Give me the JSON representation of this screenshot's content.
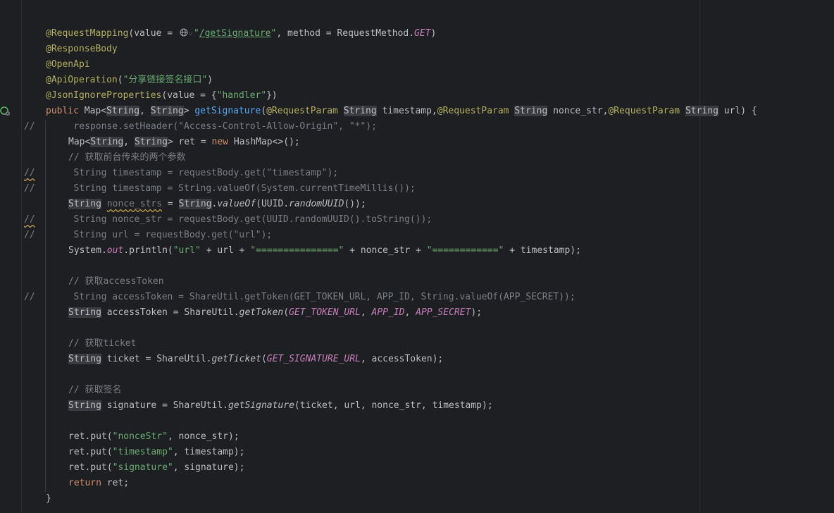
{
  "editor": {
    "lines": [
      {
        "parts": [
          {
            "t": "@RequestMapping",
            "c": "ann"
          },
          {
            "t": "(value = ",
            "c": ""
          },
          {
            "icon": "web-endpoint-icon"
          },
          {
            "t": "\"",
            "c": "str"
          },
          {
            "t": "/getSignature",
            "c": "ulink"
          },
          {
            "t": "\"",
            "c": "str"
          },
          {
            "t": ", method = RequestMethod.",
            "c": ""
          },
          {
            "t": "GET",
            "c": "fld"
          },
          {
            "t": ")",
            "c": ""
          }
        ]
      },
      {
        "parts": [
          {
            "t": "@ResponseBody",
            "c": "ann"
          }
        ]
      },
      {
        "parts": [
          {
            "t": "@OpenApi",
            "c": "ann"
          }
        ]
      },
      {
        "parts": [
          {
            "t": "@ApiOperation",
            "c": "ann"
          },
          {
            "t": "(",
            "c": ""
          },
          {
            "t": "\"分享链接签名接口\"",
            "c": "str"
          },
          {
            "t": ")",
            "c": ""
          }
        ]
      },
      {
        "parts": [
          {
            "t": "@JsonIgnoreProperties",
            "c": "ann"
          },
          {
            "t": "(value = {",
            "c": ""
          },
          {
            "t": "\"handler\"",
            "c": "str"
          },
          {
            "t": "})",
            "c": ""
          }
        ]
      },
      {
        "gutter_icon": "endpoint-gutter-icon",
        "parts": [
          {
            "t": "public ",
            "c": "kw"
          },
          {
            "t": "Map<",
            "c": ""
          },
          {
            "t": "String",
            "c": "hl"
          },
          {
            "t": ", ",
            "c": ""
          },
          {
            "t": "String",
            "c": "hl"
          },
          {
            "t": "> ",
            "c": ""
          },
          {
            "t": "getSignature",
            "c": "fn"
          },
          {
            "t": "(",
            "c": ""
          },
          {
            "t": "@RequestParam ",
            "c": "ann"
          },
          {
            "t": "String",
            "c": "hl"
          },
          {
            "t": " timestamp,",
            "c": ""
          },
          {
            "t": "@RequestParam ",
            "c": "ann"
          },
          {
            "t": "String",
            "c": "hl"
          },
          {
            "t": " nonce_str,",
            "c": ""
          },
          {
            "t": "@RequestParam ",
            "c": "ann"
          },
          {
            "t": "String",
            "c": "hl"
          },
          {
            "t": " url) {",
            "c": ""
          }
        ]
      },
      {
        "mark": "//",
        "indent": 2,
        "parts": [
          {
            "t": "   response.setHeader(\"Access-Control-Allow-Origin\", \"*\");",
            "c": "cmtcode"
          }
        ]
      },
      {
        "indent": 1,
        "parts": [
          {
            "t": "Map<",
            "c": ""
          },
          {
            "t": "String",
            "c": "hl"
          },
          {
            "t": ", ",
            "c": ""
          },
          {
            "t": "String",
            "c": "hl"
          },
          {
            "t": "> ret = ",
            "c": ""
          },
          {
            "t": "new ",
            "c": "kw"
          },
          {
            "t": "HashMap<>();",
            "c": ""
          }
        ]
      },
      {
        "indent": 1,
        "parts": [
          {
            "t": "// 获取前台传来的两个参数",
            "c": "cmt"
          }
        ]
      },
      {
        "mark": "//",
        "mark_squiggle": true,
        "indent": 2,
        "parts": [
          {
            "t": "   String timestamp = requestBody.get(\"timestamp\");",
            "c": "cmtcode"
          }
        ]
      },
      {
        "mark": "//",
        "indent": 2,
        "parts": [
          {
            "t": "   String timestamp = String.valueOf(System.currentTimeMillis());",
            "c": "cmtcode"
          }
        ]
      },
      {
        "indent": 1,
        "parts": [
          {
            "t": "String",
            "c": "hl"
          },
          {
            "t": " ",
            "c": ""
          },
          {
            "t": "nonce_strs",
            "c": "dim squig"
          },
          {
            "t": " = ",
            "c": ""
          },
          {
            "t": "String",
            "c": "hl"
          },
          {
            "t": ".",
            "c": ""
          },
          {
            "t": "valueOf",
            "c": "it"
          },
          {
            "t": "(UUID.",
            "c": ""
          },
          {
            "t": "randomUUID",
            "c": "it"
          },
          {
            "t": "());",
            "c": ""
          }
        ]
      },
      {
        "mark": "//",
        "mark_squiggle": true,
        "indent": 2,
        "parts": [
          {
            "t": "   String nonce_str = requestBody.get(UUID.randomUUID().toString());",
            "c": "cmtcode"
          }
        ]
      },
      {
        "mark": "//",
        "indent": 2,
        "parts": [
          {
            "t": "   String url = requestBody.get(\"url\");",
            "c": "cmtcode"
          }
        ]
      },
      {
        "indent": 1,
        "parts": [
          {
            "t": "System.",
            "c": ""
          },
          {
            "t": "out",
            "c": "fld"
          },
          {
            "t": ".println(",
            "c": ""
          },
          {
            "t": "\"url\"",
            "c": "str"
          },
          {
            "t": " + url + ",
            "c": ""
          },
          {
            "t": "\"===============\"",
            "c": "str"
          },
          {
            "t": " + nonce_str + ",
            "c": ""
          },
          {
            "t": "\"============\"",
            "c": "str"
          },
          {
            "t": " + timestamp);",
            "c": ""
          }
        ]
      },
      {
        "parts": []
      },
      {
        "indent": 1,
        "parts": [
          {
            "t": "// 获取accessToken",
            "c": "cmt"
          }
        ]
      },
      {
        "mark": "//",
        "indent": 2,
        "parts": [
          {
            "t": "   String accessToken = ShareUtil.getToken(GET_TOKEN_URL, APP_ID, String.valueOf(APP_SECRET));",
            "c": "cmtcode"
          }
        ]
      },
      {
        "indent": 1,
        "parts": [
          {
            "t": "String",
            "c": "hl"
          },
          {
            "t": " accessToken = ShareUtil.",
            "c": ""
          },
          {
            "t": "getToken",
            "c": "it"
          },
          {
            "t": "(",
            "c": ""
          },
          {
            "t": "GET_TOKEN_URL",
            "c": "fld"
          },
          {
            "t": ", ",
            "c": ""
          },
          {
            "t": "APP_ID",
            "c": "fld"
          },
          {
            "t": ", ",
            "c": ""
          },
          {
            "t": "APP_SECRET",
            "c": "fld"
          },
          {
            "t": ");",
            "c": ""
          }
        ]
      },
      {
        "parts": []
      },
      {
        "indent": 1,
        "parts": [
          {
            "t": "// 获取ticket",
            "c": "cmt"
          }
        ]
      },
      {
        "indent": 1,
        "parts": [
          {
            "t": "String",
            "c": "hl"
          },
          {
            "t": " ticket = ShareUtil.",
            "c": ""
          },
          {
            "t": "getTicket",
            "c": "it"
          },
          {
            "t": "(",
            "c": ""
          },
          {
            "t": "GET_SIGNATURE_URL",
            "c": "fld"
          },
          {
            "t": ", accessToken);",
            "c": ""
          }
        ]
      },
      {
        "parts": []
      },
      {
        "indent": 1,
        "parts": [
          {
            "t": "// 获取签名",
            "c": "cmt"
          }
        ]
      },
      {
        "indent": 1,
        "parts": [
          {
            "t": "String",
            "c": "hl"
          },
          {
            "t": " signature = ShareUtil.",
            "c": ""
          },
          {
            "t": "getSignature",
            "c": "it"
          },
          {
            "t": "(ticket, url, nonce_str, timestamp);",
            "c": ""
          }
        ]
      },
      {
        "parts": []
      },
      {
        "indent": 1,
        "parts": [
          {
            "t": "ret.put(",
            "c": ""
          },
          {
            "t": "\"nonceStr\"",
            "c": "str"
          },
          {
            "t": ", nonce_str);",
            "c": ""
          }
        ]
      },
      {
        "indent": 1,
        "parts": [
          {
            "t": "ret.put(",
            "c": ""
          },
          {
            "t": "\"timestamp\"",
            "c": "str"
          },
          {
            "t": ", timestamp);",
            "c": ""
          }
        ]
      },
      {
        "indent": 1,
        "parts": [
          {
            "t": "ret.put(",
            "c": ""
          },
          {
            "t": "\"signature\"",
            "c": "str"
          },
          {
            "t": ", signature);",
            "c": ""
          }
        ]
      },
      {
        "indent": 1,
        "parts": [
          {
            "t": "return ",
            "c": "kw"
          },
          {
            "t": "ret;",
            "c": ""
          }
        ]
      },
      {
        "parts": [
          {
            "t": "}",
            "c": ""
          }
        ]
      }
    ]
  }
}
